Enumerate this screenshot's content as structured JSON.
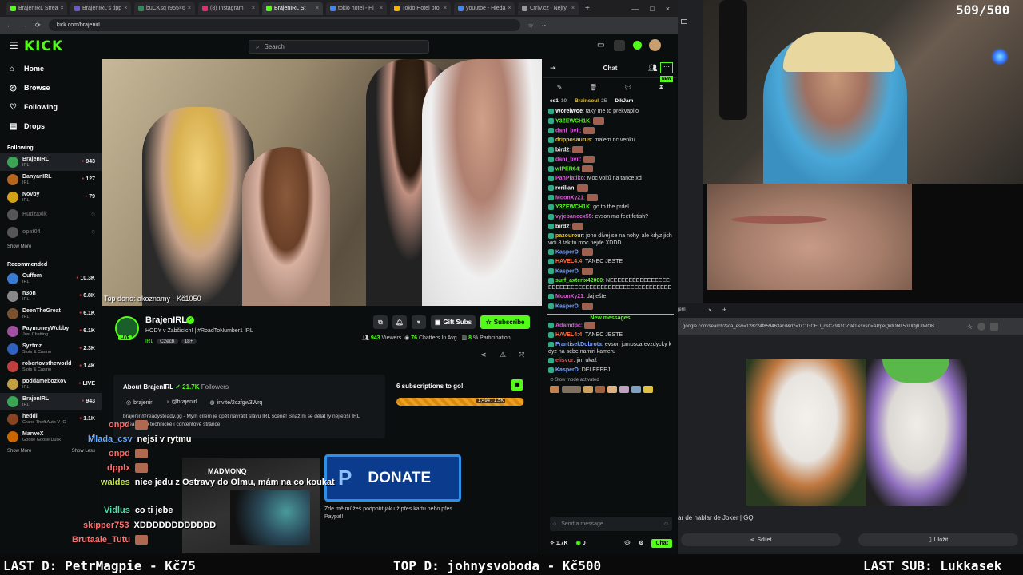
{
  "browser": {
    "tabs": [
      {
        "label": "BrajenIRL Strea",
        "color": "#53fc18"
      },
      {
        "label": "BrajenIRL's tipp",
        "color": "#6a5acd"
      },
      {
        "label": "buCKsq (955×6",
        "color": "#2e8b57"
      },
      {
        "label": "(8) Instagram",
        "color": "#e1306c"
      },
      {
        "label": "BrajenIRL St",
        "color": "#53fc18"
      },
      {
        "label": "tokio hotel - Hl",
        "color": "#4285f4"
      },
      {
        "label": "Tokio Hotel pro",
        "color": "#f4b400"
      },
      {
        "label": "youutbe - Hleda",
        "color": "#4285f4"
      },
      {
        "label": "CtrlV.cz | Nejry",
        "color": "#999999"
      }
    ],
    "url": "kick.com/brajenirl"
  },
  "header": {
    "logo": "KICK",
    "search_placeholder": "Search"
  },
  "sidebar": {
    "nav": [
      {
        "label": "Home",
        "icon": "home-icon"
      },
      {
        "label": "Browse",
        "icon": "compass-icon"
      },
      {
        "label": "Following",
        "icon": "heart-icon"
      },
      {
        "label": "Drops",
        "icon": "gift-icon"
      }
    ],
    "following_title": "Following",
    "following": [
      {
        "name": "BrajenIRL",
        "sub": "IRL",
        "count": "943",
        "color": "#3aa655"
      },
      {
        "name": "DanyanIRL",
        "sub": "IRL",
        "count": "127",
        "color": "#b5651d"
      },
      {
        "name": "Novby",
        "sub": "IRL",
        "count": "79",
        "color": "#d4a017"
      },
      {
        "name": "Hudzaxik",
        "sub": "",
        "count": "",
        "color": "#555555"
      },
      {
        "name": "opat04",
        "sub": "",
        "count": "",
        "color": "#555555"
      }
    ],
    "show_more": "Show More",
    "recommended_title": "Recommended",
    "recommended": [
      {
        "name": "Cuffem",
        "sub": "IRL",
        "count": "10.3K",
        "color": "#3a7bd5"
      },
      {
        "name": "n3on",
        "sub": "IRL",
        "count": "6.8K",
        "color": "#888888"
      },
      {
        "name": "DeenTheGreat",
        "sub": "IRL",
        "count": "6.1K",
        "color": "#7a5230"
      },
      {
        "name": "PaymoneyWubby",
        "sub": "Just Chatting",
        "count": "6.1K",
        "color": "#a050a0"
      },
      {
        "name": "Syztmz",
        "sub": "Slots & Casino",
        "count": "2.3K",
        "color": "#3060c0"
      },
      {
        "name": "robertovstheworld",
        "sub": "Slots & Casino",
        "count": "1.4K",
        "color": "#c04040"
      },
      {
        "name": "poddamebozkov",
        "sub": "IRL",
        "count": "LIVE",
        "color": "#c0a040"
      },
      {
        "name": "BrajenIRL",
        "sub": "IRL",
        "count": "943",
        "color": "#3aa655"
      },
      {
        "name": "heddi",
        "sub": "Grand Theft Auto V (G",
        "count": "1.1K",
        "color": "#884422"
      },
      {
        "name": "MarweX",
        "sub": "Goose Goose Duck",
        "count": "4",
        "color": "#cc6600"
      }
    ],
    "show_more2": "Show More",
    "show_less": "Show Less"
  },
  "video": {
    "caption": "Top dono: akoznamy - Kč1050"
  },
  "stream": {
    "name": "BrajenIRL",
    "title": "HODY v Žabčicích! | #RoadToNumber1 IRL",
    "tags": [
      "IRL",
      "Czech",
      "18+"
    ],
    "live": "LIVE",
    "gift_subs": "Gift Subs",
    "subscribe": "Subscribe",
    "viewers": "943",
    "viewers_label": "Viewers",
    "chatters": "76",
    "chatters_label": "Chatters In Avg.",
    "participation": "8",
    "participation_label": "% Participation",
    "about_title": "About BrajenIRL",
    "followers": "21.7K",
    "followers_label": "Followers",
    "socials": [
      {
        "label": "brajenirl",
        "icon": "instagram-icon"
      },
      {
        "label": "@brajenirl",
        "icon": "tiktok-icon"
      },
      {
        "label": "invite/2czfgw3Wrq",
        "icon": "discord-icon"
      }
    ],
    "bio": "brajenirl@readysteady.gg - Mým cílem je opět navrátit slávu IRL scéně! Snažím se dělat ty nejlepší IRL streamy po technické i contentové stránce!",
    "sub_goal_title": "6 subscriptions to go!",
    "sub_goal_value": "1,494 / 1.5K",
    "sub_goal_fraction": 0.996,
    "donate": "DONATE",
    "donate_text": "Zde mě můžeš podpořit jak už přes kartu nebo přes Paypal!",
    "sponsor": "MADMONQ"
  },
  "overlay_chat": [
    {
      "user": "onpd",
      "text": "",
      "color": "#ff6b6b"
    },
    {
      "user": "Mlada_csv",
      "text": "nejsi v rytmu",
      "color": "#66aaff"
    },
    {
      "user": "onpd",
      "text": "",
      "color": "#ff6b6b"
    },
    {
      "user": "dpplx",
      "text": "",
      "color": "#ff6b6b"
    },
    {
      "user": "waldes",
      "text": "nice jedu z Ostravy do Olmu, mám na co koukat",
      "color": "#c7e84d"
    },
    {
      "user": "Vidlus",
      "text": "co ti jebe",
      "color": "#55ddaa"
    },
    {
      "user": "skipper753",
      "text": "XDDDDDDDDDDDD",
      "color": "#ff7070"
    },
    {
      "user": "Brutaale_Tutu",
      "text": "",
      "color": "#ff7070"
    }
  ],
  "chat": {
    "title": "Chat",
    "new_badge": "NEW",
    "pinned": [
      {
        "user": "es1",
        "count": "10"
      },
      {
        "user": "Brainsoul",
        "count": "25"
      },
      {
        "user": "DikJam",
        "count": ""
      }
    ],
    "messages": [
      {
        "user": "WorelWoe",
        "text": "taky me to prekvapilo",
        "color": "#ffffff"
      },
      {
        "user": "Y3ZEWCH1K",
        "text": "",
        "color": "#53fc18"
      },
      {
        "user": "dani_bvit",
        "text": "",
        "color": "#d45fd4"
      },
      {
        "user": "dripposaurus",
        "text": "malem ric venku",
        "color": "#e6c229"
      },
      {
        "user": "bird2",
        "text": "",
        "color": "#ffffff"
      },
      {
        "user": "dani_bvit",
        "text": "",
        "color": "#d45fd4"
      },
      {
        "user": "wIPER64",
        "text": "",
        "color": "#53fc18"
      },
      {
        "user": "PanPlatiko",
        "text": "Moc voltů na tance xd",
        "color": "#d45fd4"
      },
      {
        "user": "rerilian",
        "text": "",
        "color": "#ffffff"
      },
      {
        "user": "MoonXy21",
        "text": "",
        "color": "#d45fd4"
      },
      {
        "user": "Y3ZEWCH1K",
        "text": "go to the prdel",
        "color": "#53fc18"
      },
      {
        "user": "vyjebanecx55",
        "text": "evson ma feet fetish?",
        "color": "#d45fd4"
      },
      {
        "user": "bird2",
        "text": "",
        "color": "#ffffff"
      },
      {
        "user": "pazourour",
        "text": "jono dívej se na nohy, ale kdyz jich vidi 8 tak to moc nejde XDDD",
        "color": "#e6c229"
      },
      {
        "user": "KasperD",
        "text": "",
        "color": "#7aa2ff"
      },
      {
        "user": "HAVEL4:4",
        "text": "TANEC JESTE",
        "color": "#ff6b3d"
      },
      {
        "user": "KasperD",
        "text": "",
        "color": "#7aa2ff"
      },
      {
        "user": "surf_axterix42000",
        "text": "NEEEEEEEEEEEEEEEEEEEEEEEEEEEEEEEEEEEEEEEEEEEEEEEEE",
        "color": "#53fc18"
      },
      {
        "user": "MoonXy21",
        "text": "daj ešte",
        "color": "#d45fd4"
      },
      {
        "user": "KasperD",
        "text": "",
        "color": "#7aa2ff"
      }
    ],
    "new_messages": "New messages",
    "messages2": [
      {
        "user": "Adamdpc",
        "text": "",
        "color": "#d45fd4"
      },
      {
        "user": "HAVEL4:4",
        "text": "TANEC JESTE",
        "color": "#ff6b3d"
      },
      {
        "user": "FrantisekDobrota",
        "text": "evson jumpscarevzdycky kdyz na sebe namiri kameru",
        "color": "#7aa2ff"
      },
      {
        "user": "elisvor",
        "text": "jim ukaž",
        "color": "#e05050"
      },
      {
        "user": "KasperD",
        "text": "DELEEEEJ",
        "color": "#7aa2ff"
      }
    ],
    "slow_mode": "Slow mode activated",
    "input_placeholder": "Send a message",
    "points": "1.7K",
    "zero": "0",
    "send": "Chat"
  },
  "right": {
    "counter": "509/500",
    "search_url": "google.com/search?sca_esv=128224f859463acd&rlz=1C1GCEU_csCZ941CZ941&sxsrf=APpeQntOblL5nLlOjtUIWOB...",
    "tab_fragment": "jem",
    "result_caption": "ar de hablar de Joker | GQ",
    "share": "Sdílet",
    "save": "Uložit"
  },
  "bottom": {
    "last_d": "LAST D: PetrMagpie - Kč75",
    "top_d": "TOP D: johnysvoboda - Kč500",
    "last_sub": "LAST SUB: Lukkasek"
  },
  "colors": {
    "kick_green": "#53fc18",
    "live_red": "#e33333",
    "background": "#0b0e0f"
  }
}
